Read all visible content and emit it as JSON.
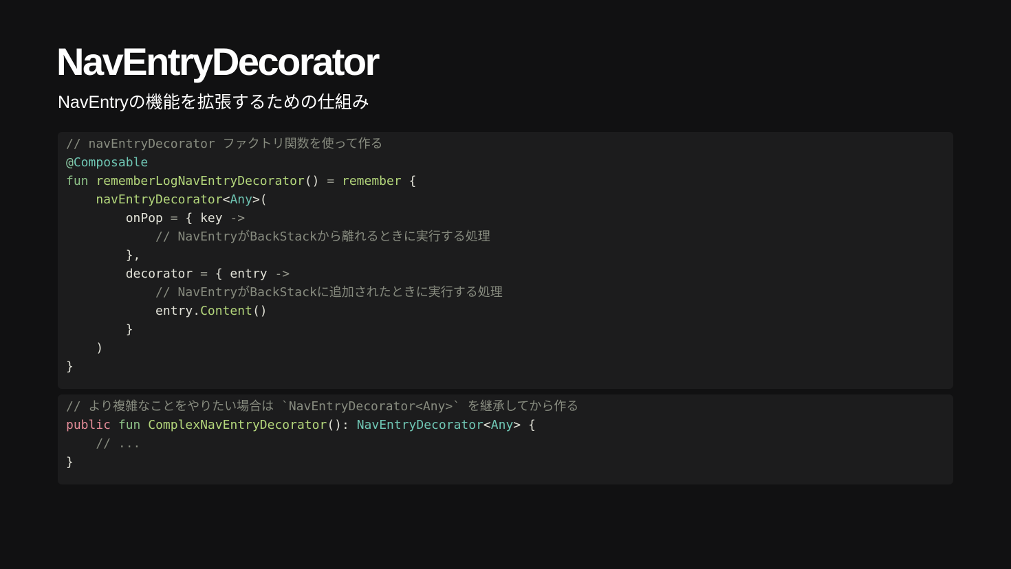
{
  "slide": {
    "title": "NavEntryDecorator",
    "subtitle": "NavEntryの機能を拡張するための仕組み"
  },
  "colors": {
    "background": "#111112",
    "code_background": "#1c1c1d",
    "comment": "#878b7f",
    "keyword": "#8cbf86",
    "function": "#b3d67b",
    "type": "#6fc6b4",
    "public_keyword": "#e48c98"
  },
  "code_blocks": [
    {
      "language": "kotlin",
      "lines": [
        [
          {
            "t": "// navEntryDecorator ファクトリ関数を使って作る",
            "k": "comment"
          }
        ],
        [
          {
            "t": "@",
            "k": "annot"
          },
          {
            "t": "Composable",
            "k": "type"
          }
        ],
        [
          {
            "t": "fun",
            "k": "keyword"
          },
          {
            "t": " ",
            "k": "plain"
          },
          {
            "t": "rememberLogNavEntryDecorator",
            "k": "func"
          },
          {
            "t": "() ",
            "k": "plain"
          },
          {
            "t": "=",
            "k": "op"
          },
          {
            "t": " ",
            "k": "plain"
          },
          {
            "t": "remember",
            "k": "func"
          },
          {
            "t": " {",
            "k": "plain"
          }
        ],
        [
          {
            "t": "    ",
            "k": "plain"
          },
          {
            "t": "navEntryDecorator",
            "k": "func"
          },
          {
            "t": "<",
            "k": "plain"
          },
          {
            "t": "Any",
            "k": "type"
          },
          {
            "t": ">(",
            "k": "plain"
          }
        ],
        [
          {
            "t": "        onPop ",
            "k": "plain"
          },
          {
            "t": "=",
            "k": "op"
          },
          {
            "t": " { key ",
            "k": "plain"
          },
          {
            "t": "->",
            "k": "op"
          }
        ],
        [
          {
            "t": "            ",
            "k": "plain"
          },
          {
            "t": "// NavEntryがBackStackから離れるときに実行する処理",
            "k": "comment"
          }
        ],
        [
          {
            "t": "        },",
            "k": "plain"
          }
        ],
        [
          {
            "t": "        decorator ",
            "k": "plain"
          },
          {
            "t": "=",
            "k": "op"
          },
          {
            "t": " { entry ",
            "k": "plain"
          },
          {
            "t": "->",
            "k": "op"
          }
        ],
        [
          {
            "t": "            ",
            "k": "plain"
          },
          {
            "t": "// NavEntryがBackStackに追加されたときに実行する処理",
            "k": "comment"
          }
        ],
        [
          {
            "t": "            entry.",
            "k": "plain"
          },
          {
            "t": "Content",
            "k": "func"
          },
          {
            "t": "()",
            "k": "plain"
          }
        ],
        [
          {
            "t": "        }",
            "k": "plain"
          }
        ],
        [
          {
            "t": "    )",
            "k": "plain"
          }
        ],
        [
          {
            "t": "}",
            "k": "plain"
          }
        ]
      ]
    },
    {
      "language": "kotlin",
      "lines": [
        [
          {
            "t": "// より複雑なことをやりたい場合は `NavEntryDecorator<Any>` を継承してから作る",
            "k": "comment"
          }
        ],
        [
          {
            "t": "public",
            "k": "public"
          },
          {
            "t": " ",
            "k": "plain"
          },
          {
            "t": "fun",
            "k": "keyword"
          },
          {
            "t": " ",
            "k": "plain"
          },
          {
            "t": "ComplexNavEntryDecorator",
            "k": "func"
          },
          {
            "t": "(): ",
            "k": "plain"
          },
          {
            "t": "NavEntryDecorator",
            "k": "type"
          },
          {
            "t": "<",
            "k": "plain"
          },
          {
            "t": "Any",
            "k": "type"
          },
          {
            "t": "> {",
            "k": "plain"
          }
        ],
        [
          {
            "t": "    ",
            "k": "plain"
          },
          {
            "t": "// ...",
            "k": "comment"
          }
        ],
        [
          {
            "t": "}",
            "k": "plain"
          }
        ]
      ]
    }
  ]
}
